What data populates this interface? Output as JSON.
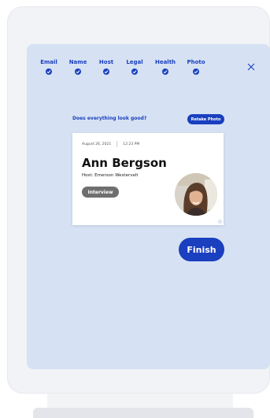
{
  "progress": {
    "steps": [
      {
        "label": "Email",
        "done": true
      },
      {
        "label": "Name",
        "done": true
      },
      {
        "label": "Host",
        "done": true
      },
      {
        "label": "Legal",
        "done": true
      },
      {
        "label": "Health",
        "done": true
      },
      {
        "label": "Photo",
        "done": true
      }
    ]
  },
  "review": {
    "prompt": "Does everything look good?",
    "retake_label": "Retake Photo"
  },
  "badge": {
    "date": "August 26, 2021",
    "time": "12:23 PM",
    "name": "Ann Bergson",
    "host": "Host: Emerson Westervelt",
    "purpose": "Interview"
  },
  "actions": {
    "finish_label": "Finish"
  },
  "colors": {
    "accent": "#1a3fbf",
    "screen_bg": "#d6e2f3",
    "pill_gray": "#6f6f6f"
  },
  "icons": {
    "close": "close-icon",
    "check": "check-icon"
  }
}
